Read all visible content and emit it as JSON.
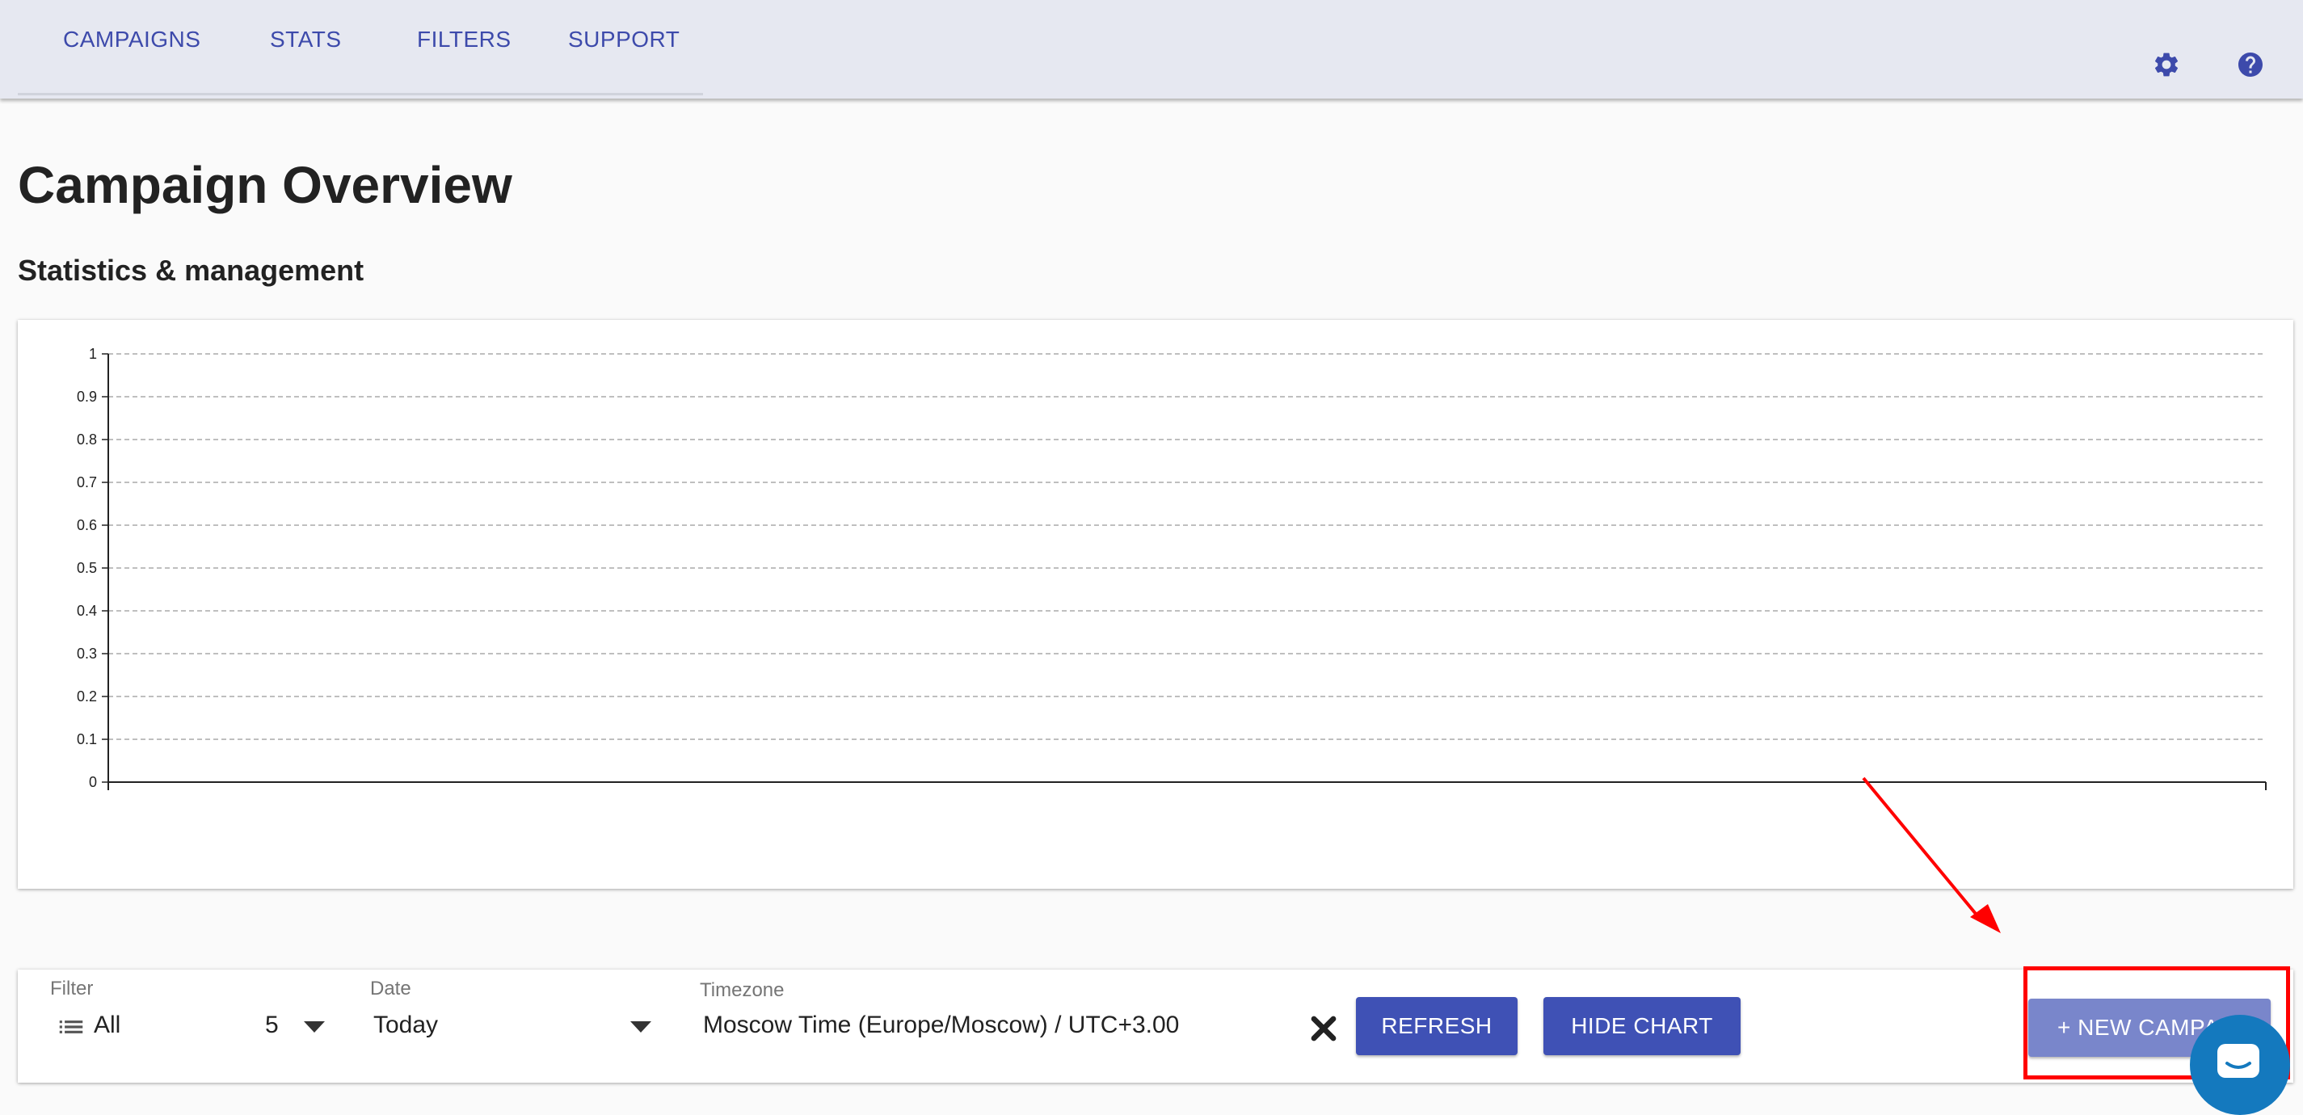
{
  "nav": {
    "tabs": [
      "CAMPAIGNS",
      "STATS",
      "FILTERS",
      "SUPPORT"
    ]
  },
  "icons": {
    "settings": "gear-icon",
    "help": "help-circle-icon",
    "filter": "list-icon",
    "clear": "close-icon",
    "chat": "chat-bubble-icon"
  },
  "page": {
    "title": "Campaign Overview",
    "subtitle": "Statistics & management"
  },
  "chart_data": {
    "type": "line",
    "title": "",
    "xlabel": "",
    "ylabel": "",
    "y_ticks": [
      "0",
      "0.1",
      "0.2",
      "0.3",
      "0.4",
      "0.5",
      "0.6",
      "0.7",
      "0.8",
      "0.9",
      "1"
    ],
    "ylim": [
      0,
      1
    ],
    "grid": true,
    "series": []
  },
  "toolbar": {
    "filter": {
      "label": "Filter",
      "value": "All",
      "count": "5"
    },
    "date": {
      "label": "Date",
      "value": "Today"
    },
    "timezone": {
      "label": "Timezone",
      "value": "Moscow Time (Europe/Moscow) / UTC+3.00"
    },
    "refresh_label": "REFRESH",
    "hide_chart_label": "HIDE CHART",
    "new_campaign_label": "+ NEW CAMPAIGN"
  },
  "colors": {
    "primary": "#3f51b5",
    "primary_light": "#7986cb",
    "nav_bg": "#e6e8f1",
    "annotation": "#ff0000",
    "chat": "#1479be"
  }
}
